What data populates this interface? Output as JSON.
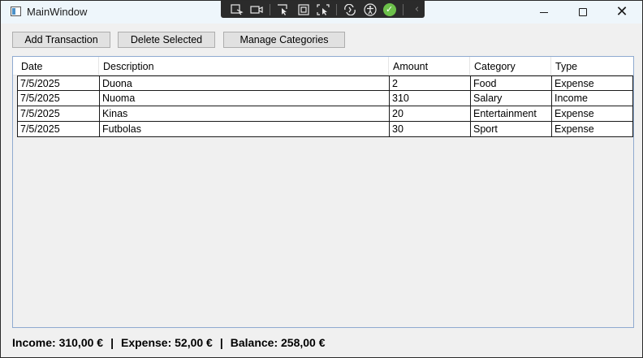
{
  "window": {
    "title": "MainWindow",
    "minimize_icon": "minimize-icon",
    "maximize_icon": "maximize-icon",
    "close_glyph": "✕"
  },
  "debug_toolbar": {
    "icons": [
      "select-element-icon",
      "record-icon",
      "pointer-icon",
      "layout-adorner-icon",
      "track-focus-icon",
      "hot-reload-icon",
      "accessibility-icon",
      "check-icon",
      "collapse-icon"
    ]
  },
  "toolbar": {
    "add_label": "Add Transaction",
    "delete_label": "Delete Selected",
    "manage_label": "Manage Categories"
  },
  "grid": {
    "columns": [
      "Date",
      "Description",
      "Amount",
      "Category",
      "Type"
    ],
    "rows": [
      [
        "7/5/2025",
        "Duona",
        "2",
        "Food",
        "Expense"
      ],
      [
        "7/5/2025",
        "Nuoma",
        "310",
        "Salary",
        "Income"
      ],
      [
        "7/5/2025",
        "Kinas",
        "20",
        "Entertainment",
        "Expense"
      ],
      [
        "7/5/2025",
        "Futbolas",
        "30",
        "Sport",
        "Expense"
      ]
    ]
  },
  "summary": {
    "income": "Income: 310,00 €",
    "separator": "|",
    "expense": "Expense: 52,00 €",
    "balance": "Balance: 258,00 €"
  },
  "colors": {
    "titlebar": "#eef6fb",
    "window_bg": "#f0f0f0",
    "grid_border": "#8faad0",
    "button_bg": "#e1e1e1",
    "check_green": "#6cc04a"
  }
}
